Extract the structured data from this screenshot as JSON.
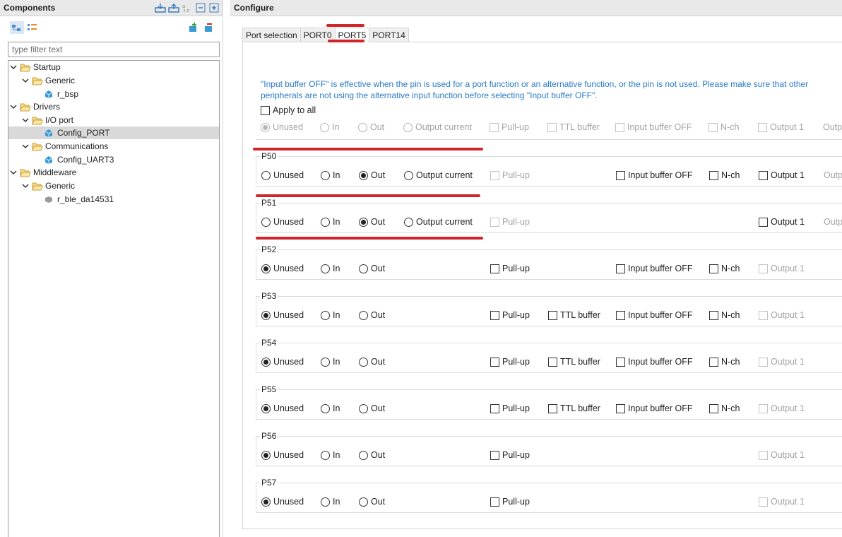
{
  "components": {
    "title": "Components",
    "filter_placeholder": "type filter text",
    "tree": [
      {
        "label": "Startup"
      },
      {
        "label": "Generic"
      },
      {
        "label": "r_bsp"
      },
      {
        "label": "Drivers"
      },
      {
        "label": "I/O port"
      },
      {
        "label": "Config_PORT"
      },
      {
        "label": "Communications"
      },
      {
        "label": "Config_UART3"
      },
      {
        "label": "Middleware"
      },
      {
        "label": "Generic"
      },
      {
        "label": "r_ble_da14531"
      }
    ]
  },
  "configure": {
    "title": "Configure",
    "tabs": [
      "Port selection",
      "PORT0",
      "PORT5",
      "PORT14"
    ],
    "active_tab": "PORT5",
    "note": "\"Input buffer OFF\" is effective when the pin is used for a port function or an alternative function, or the pin is not used. Please make sure that other peripherals are not using the alternative input function before selecting \"Input buffer OFF\".",
    "apply_all_label": "Apply to all",
    "labels": {
      "unused": "Unused",
      "in": "In",
      "out": "Out",
      "output_current": "Output current",
      "pullup": "Pull-up",
      "ttl": "TTL buffer",
      "ibuf": "Input buffer OFF",
      "nch": "N-ch",
      "output1": "Output 1",
      "outp_trunc": "Outp"
    },
    "ports": [
      {
        "name": "P50",
        "selected": "Out"
      },
      {
        "name": "P51",
        "selected": "Out"
      },
      {
        "name": "P52",
        "selected": "Unused"
      },
      {
        "name": "P53",
        "selected": "Unused"
      },
      {
        "name": "P54",
        "selected": "Unused"
      },
      {
        "name": "P55",
        "selected": "Unused"
      },
      {
        "name": "P56",
        "selected": "Unused"
      },
      {
        "name": "P57",
        "selected": "Unused"
      }
    ]
  },
  "colors": {
    "annotation_red": "#d0262b",
    "note_blue": "#2a7bc6"
  }
}
